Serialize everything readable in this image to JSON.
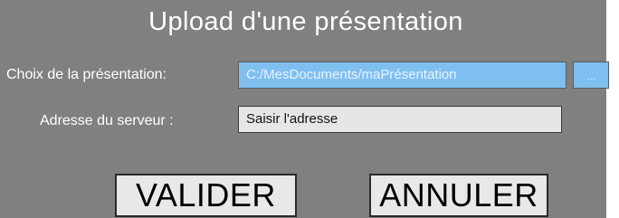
{
  "dialog": {
    "title": "Upload d'une présentation",
    "file": {
      "label": "Choix de la présentation:",
      "value": "C:/MesDocuments/maPrésentation",
      "browse_label": "..."
    },
    "server": {
      "label": "Adresse du serveur :",
      "value": "Saisir l'adresse"
    },
    "buttons": {
      "validate_label": "VALIDER",
      "cancel_label": "ANNULER"
    }
  },
  "colors": {
    "dialog_background": "#808080",
    "file_field_background": "#7fbff0",
    "server_field_background": "#e6e6e6",
    "button_background": "#e8e8e8"
  }
}
